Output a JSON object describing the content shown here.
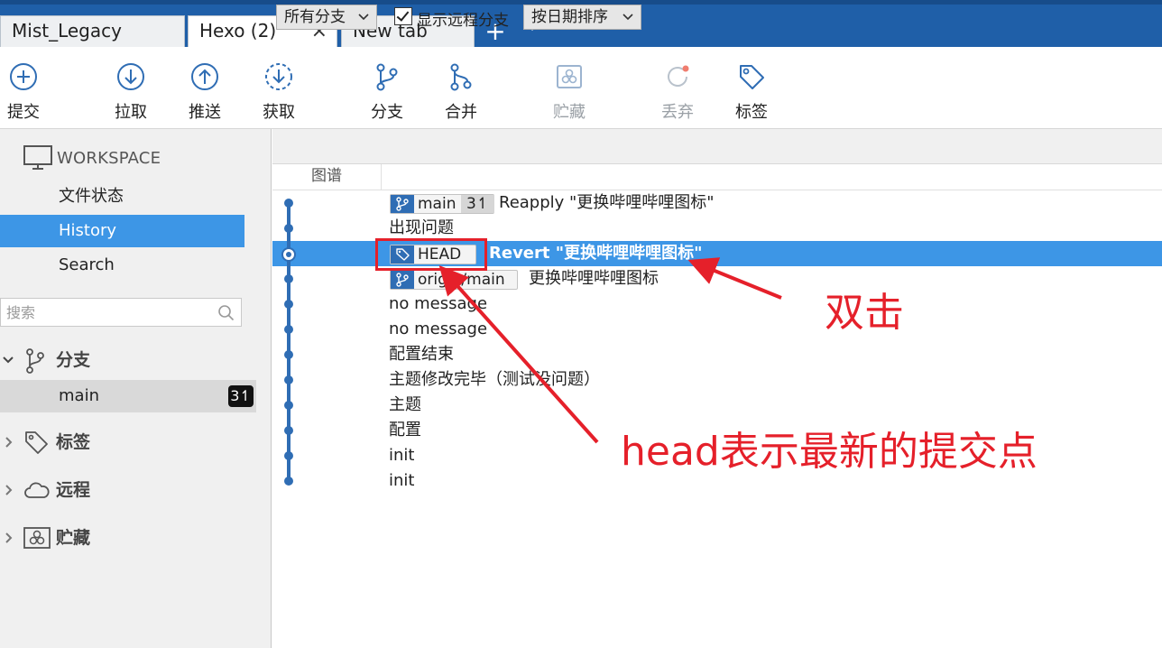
{
  "tabs": [
    {
      "label": "Mist_Legacy",
      "active": false
    },
    {
      "label": "Hexo (2)",
      "active": true,
      "closable": true
    },
    {
      "label": "New tab",
      "active": false
    }
  ],
  "tab_bar": {
    "add_icon": "plus-icon",
    "menu_icon": "chevron-down-icon",
    "close_glyph": "×"
  },
  "toolbar": {
    "commit": "提交",
    "pull": "拉取",
    "push": "推送",
    "fetch": "获取",
    "branch": "分支",
    "merge": "合并",
    "stash": "贮藏",
    "discard": "丢弃",
    "tag": "标签"
  },
  "sidebar": {
    "workspace_label": "WORKSPACE",
    "workspace_items": [
      {
        "label": "文件状态",
        "selected": false
      },
      {
        "label": "History",
        "selected": true
      },
      {
        "label": "Search",
        "selected": false
      }
    ],
    "search_placeholder": "搜索",
    "sections": {
      "branches": {
        "label": "分支",
        "expanded": true
      },
      "tags": {
        "label": "标签",
        "expanded": false
      },
      "remotes": {
        "label": "远程",
        "expanded": false
      },
      "stashes": {
        "label": "贮藏",
        "expanded": false
      }
    },
    "branches": [
      {
        "name": "main",
        "badge": "3↿"
      }
    ]
  },
  "filters": {
    "branch_filter": "所有分支",
    "show_remote_label": "显示远程分支",
    "show_remote_checked": true,
    "sort": "按日期排序"
  },
  "columns": {
    "graph": "图谱"
  },
  "commits": [
    {
      "message": "Reapply \"更换哔哩哔哩图标\"",
      "ref": "main",
      "ref_count": "3↿"
    },
    {
      "message": "出现问题"
    },
    {
      "message": "Revert \"更换哔哩哔哩图标\"",
      "ref": "HEAD",
      "selected": true
    },
    {
      "message": "更换哔哩哔哩图标",
      "ref": "origin/main"
    },
    {
      "message": "no message"
    },
    {
      "message": "no message"
    },
    {
      "message": "配置结束"
    },
    {
      "message": "主题修改完毕（测试没问题）"
    },
    {
      "message": "主题"
    },
    {
      "message": "配置"
    },
    {
      "message": "init"
    },
    {
      "message": "init"
    }
  ],
  "annotations": {
    "double_click": "双击",
    "head_explain": "head表示最新的提交点",
    "color": "#e5202a"
  },
  "colors": {
    "accent": "#3d96e6",
    "tabbar": "#1f5fa8",
    "graph": "#2f6db4"
  }
}
